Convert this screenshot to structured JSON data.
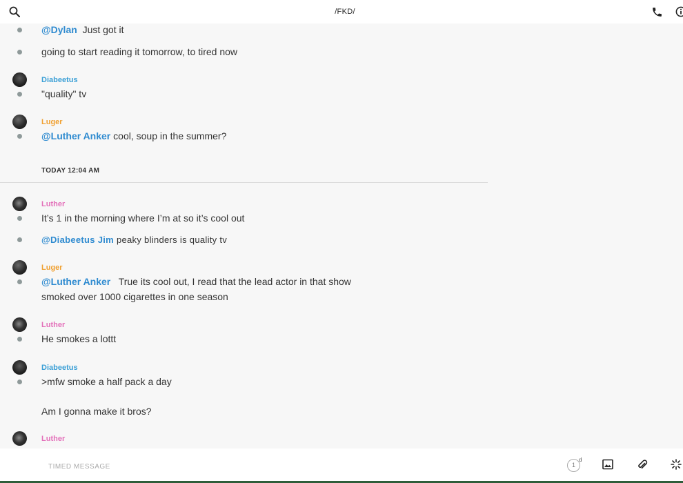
{
  "header": {
    "title": "/FKD/",
    "icons": [
      "search-icon",
      "phone-icon",
      "info-icon"
    ]
  },
  "messages_before": [
    {
      "mention": "@Dylan",
      "text": "Just got it"
    },
    {
      "text": "going to start reading it tomorrow, to tired now"
    },
    {
      "author": "Diabeetus",
      "author_color": "#3a9fd6",
      "text": "\"quality\" tv"
    },
    {
      "author": "Luger",
      "author_color": "#f0a030",
      "mention": "@Luther Anker",
      "text": "cool, soup in the summer?"
    }
  ],
  "divider": {
    "label": "TODAY 12:04 AM"
  },
  "messages_after": [
    {
      "author": "Luther",
      "author_color": "#e36fb9",
      "text": "It’s 1 in the morning where I’m at so it’s cool out"
    },
    {
      "mention": "@Diabeetus Jim",
      "text": "peaky blinders is quality tv"
    },
    {
      "author": "Luger",
      "author_color": "#f0a030",
      "mention": "@Luther Anker",
      "text_line1": "True its cool out, I read that the lead actor in that show",
      "text_line2": "smoked over 1000 cigarettes in one season"
    },
    {
      "author": "Luther",
      "author_color": "#e36fb9",
      "text": "He smokes a lottt"
    },
    {
      "author": "Diabeetus",
      "author_color": "#3a9fd6",
      "text_line1": ">mfw smoke a half pack a day",
      "text_line2": "Am I gonna make it bros?"
    },
    {
      "author": "Luther",
      "author_color": "#e36fb9"
    }
  ],
  "composer": {
    "placeholder": "TIMED MESSAGE",
    "timer_value": "1",
    "timer_unit": "d",
    "icons": [
      "timer-icon",
      "image-icon",
      "attachment-icon",
      "sparkle-icon"
    ]
  }
}
